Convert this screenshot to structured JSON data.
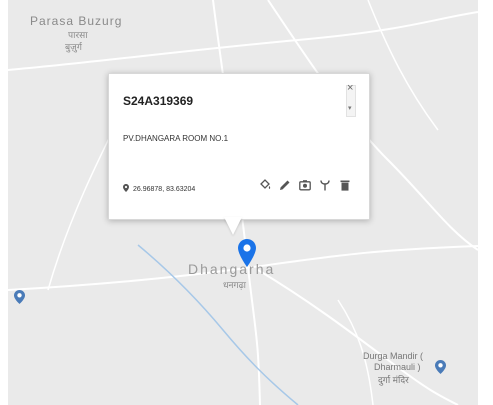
{
  "map": {
    "places": {
      "parasa_buzurg_en": "Parasa Buzurg",
      "parasa_hi": "पारसा",
      "buzurg_hi": "बुज़ुर्ग",
      "dhangarha_en": "Dhangarha",
      "dhangarha_hi": "धनगढ़ा",
      "durga_mandir_line1": "Durga Mandir (",
      "durga_mandir_line2": "Dharmauli )",
      "durga_mandir_hi": "दुर्गा मंदिर"
    },
    "marker_icon": "map-pin-icon",
    "colors": {
      "map_background": "#eaeaea",
      "road": "#ffffff",
      "river": "#a7c8e8",
      "marker": "#1a73e8",
      "poi": "#4a7bb8"
    }
  },
  "popup": {
    "title": "S24A319369",
    "address": "PV.DHANGARA ROOM NO.1",
    "coordinates": "26.96878, 83.63204",
    "close_label": "×",
    "scroll_caret": "▾",
    "actions": [
      "paint-bucket-icon",
      "pencil-icon",
      "camera-icon",
      "antenna-icon",
      "trash-icon"
    ]
  }
}
